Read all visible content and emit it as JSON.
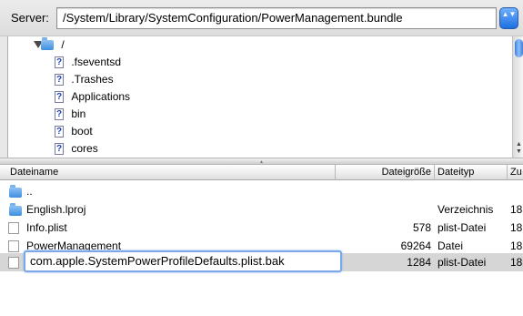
{
  "server": {
    "label": "Server:",
    "path": "/System/Library/SystemConfiguration/PowerManagement.bundle",
    "stepper": "▲▼"
  },
  "tree": {
    "root": "/",
    "items": [
      ".fseventsd",
      ".Trashes",
      "Applications",
      "bin",
      "boot",
      "cores"
    ]
  },
  "columns": {
    "name": "Dateiname",
    "size": "Dateigröße",
    "type": "Dateityp",
    "modified": "Zu"
  },
  "files": [
    {
      "name": "..",
      "size": "",
      "type": "",
      "modified": "",
      "icon": "folder-icon"
    },
    {
      "name": "English.lproj",
      "size": "",
      "type": "Verzeichnis",
      "modified": "18",
      "icon": "folder-icon"
    },
    {
      "name": "Info.plist",
      "size": "578",
      "type": "plist-Datei",
      "modified": "18",
      "icon": "file-icon"
    },
    {
      "name": "PowerManagement",
      "size": "69264",
      "type": "Datei",
      "modified": "18",
      "icon": "file-icon"
    },
    {
      "name": "com.apple.SystemPowerProfileDefaults.plist.bak",
      "size": "1284",
      "type": "plist-Datei",
      "modified": "18",
      "icon": "file-icon",
      "selected": true
    }
  ],
  "accent": "#3d7fd6"
}
